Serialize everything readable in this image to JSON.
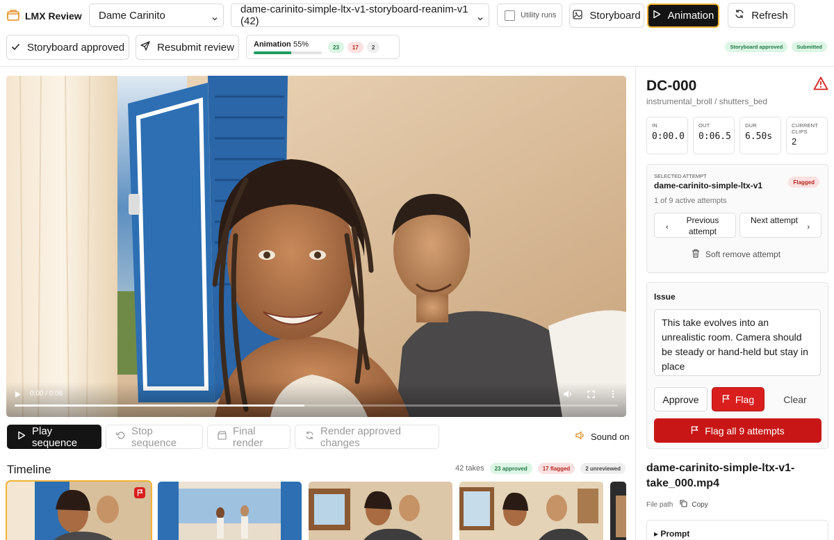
{
  "app": {
    "title": "LMX Review",
    "logo_icon": "folder-stack-icon"
  },
  "toolbar": {
    "project_select": "Dame Carinito",
    "run_select": "dame-carinito-simple-ltx-v1-storyboard-reanim-v1 (42)",
    "utility_runs_label": "Utility runs",
    "utility_runs_checked": false,
    "storyboard_label": "Storyboard",
    "animation_label": "Animation",
    "animation_active": true,
    "refresh_label": "Refresh"
  },
  "actions": {
    "storyboard_approved_label": "Storyboard approved",
    "resubmit_label": "Resubmit review"
  },
  "progress": {
    "label": "Animation",
    "percent_text": "55%",
    "fraction": 0.55,
    "approved": "23",
    "flagged": "17",
    "unreviewed": "2"
  },
  "status_badges": [
    "Storyboard approved",
    "Submitted"
  ],
  "video": {
    "time_text": "0:00 / 0:06",
    "progress_fraction": 0.48
  },
  "sequence": {
    "play_label": "Play sequence",
    "stop_label": "Stop sequence",
    "final_render_label": "Final render",
    "render_approved_label": "Render approved changes",
    "sound_label": "Sound on"
  },
  "timeline": {
    "title": "Timeline",
    "takes_text": "42 takes",
    "approved_text": "23 approved",
    "flagged_text": "17 flagged",
    "unreviewed_text": "2 unreviewed"
  },
  "shot": {
    "id": "DC-000",
    "path": "instrumental_broll / shutters_bed",
    "stats": [
      {
        "label": "IN",
        "value": "0:00.0"
      },
      {
        "label": "OUT",
        "value": "0:06.5"
      },
      {
        "label": "DUR",
        "value": "6.50s"
      },
      {
        "label": "CURRENT CLIPS",
        "value": "2"
      }
    ]
  },
  "attempt": {
    "section_label": "SELECTED ATTEMPT",
    "name": "dame-carinito-simple-ltx-v1",
    "status": "Flagged",
    "count_text": "1 of 9 active attempts",
    "prev_label": "Previous attempt",
    "next_label": "Next attempt",
    "soft_remove_label": "Soft remove attempt"
  },
  "issue": {
    "label": "Issue",
    "text": "This take evolves into an unrealistic room. Camera should be steady or hand-held but stay in place",
    "approve_label": "Approve",
    "flag_label": "Flag",
    "clear_label": "Clear",
    "flag_all_label": "Flag all 9 attempts"
  },
  "file": {
    "name": "dame-carinito-simple-ltx-v1-take_000.mp4",
    "path_label": "File path",
    "copy_label": "Copy",
    "prompt_label": "▸ Prompt"
  },
  "colors": {
    "accent": "#f2b233",
    "danger": "#d91e1e",
    "success": "#1f9d62"
  }
}
